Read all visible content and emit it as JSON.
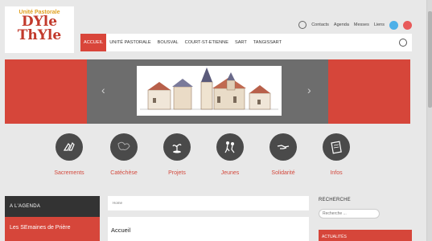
{
  "logo": {
    "tagline": "Unité Pastorale",
    "line1": "DYle",
    "line2": "ThYle"
  },
  "topbar": {
    "contacts": "Contacts",
    "agenda": "Agenda",
    "messes": "Messes",
    "liens": "Liens"
  },
  "nav": {
    "items": [
      "ACCUEIL",
      "UNITÉ PASTORALE",
      "BOUSVAL",
      "COURT-ST-ETIENNE",
      "SART",
      "TANGISSART"
    ],
    "active_index": 0
  },
  "slider": {
    "prev": "‹",
    "next": "›"
  },
  "categories": [
    {
      "label": "Sacrements",
      "icon": "hands-icon"
    },
    {
      "label": "Catéchèse",
      "icon": "map-icon"
    },
    {
      "label": "Projets",
      "icon": "plant-icon"
    },
    {
      "label": "Jeunes",
      "icon": "people-icon"
    },
    {
      "label": "Solidarité",
      "icon": "handshake-icon"
    },
    {
      "label": "Infos",
      "icon": "news-icon"
    }
  ],
  "agenda": {
    "title": "A L'AGENDA",
    "first_item": "Les SEmaines de Prière"
  },
  "breadcrumb": "Home",
  "content": {
    "title": "Accueil"
  },
  "search": {
    "title": "RECHERCHE",
    "placeholder": "Recherche ..."
  },
  "news": {
    "title": "ACTUALITÉS"
  },
  "colors": {
    "accent": "#d6463a",
    "dark": "#333333",
    "background": "#e8e8e8"
  }
}
